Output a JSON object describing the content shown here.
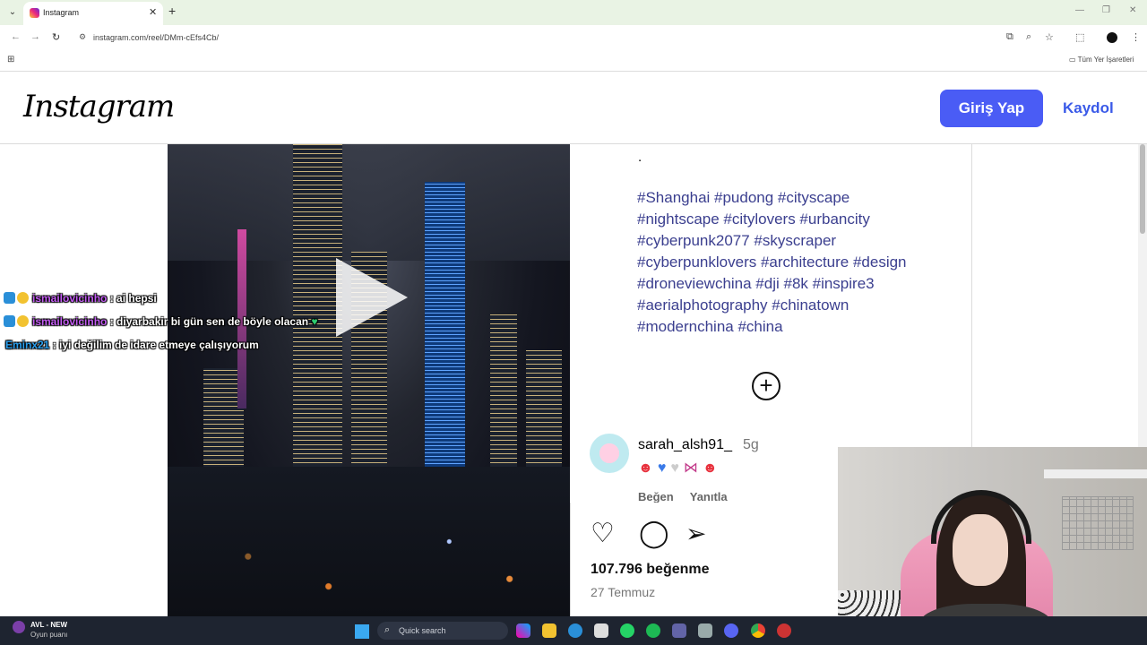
{
  "browser": {
    "tab_title": "Instagram",
    "tab_close": "✕",
    "new_tab": "+",
    "url": "instagram.com/reel/DMm-cEfs4Cb/",
    "all_bookmarks": "Tüm Yer İşaretleri"
  },
  "header": {
    "logo": "Instagram",
    "login_label": "Giriş Yap",
    "signup_label": "Kaydol"
  },
  "chat": [
    {
      "user": "ismailovicinho",
      "message": ": ai hepsi",
      "heart": ""
    },
    {
      "user": "ismailovicinho",
      "message": ": diyarbakir bi gün sen de böyle olacan",
      "heart": "♥"
    },
    {
      "user": "Eminx21",
      "message": ": iyi değilim de idare etmeye çalışıyorum",
      "heart": ""
    }
  ],
  "post": {
    "caption_dot": ".",
    "hashtags": [
      "#Shanghai #pudong #cityscape",
      "#nightscape #citylovers #urbancity",
      "#cyberpunk2077 #skyscraper",
      "#cyberpunklovers #architecture #design",
      "#droneviewchina #dji #8k #inspire3",
      "#aerialphotography #chinatown",
      "#modernchina #china"
    ],
    "add_comment_icon": "+",
    "comment": {
      "user": "sarah_alsh91_",
      "time": "5g",
      "like": "Beğen",
      "reply": "Yanıtla"
    },
    "likes": "107.796 beğenme",
    "date": "27 Temmuz"
  },
  "taskbar": {
    "game_title": "AVL - NEW",
    "game_sub": "Oyun puanı",
    "search_placeholder": "Quick search"
  }
}
